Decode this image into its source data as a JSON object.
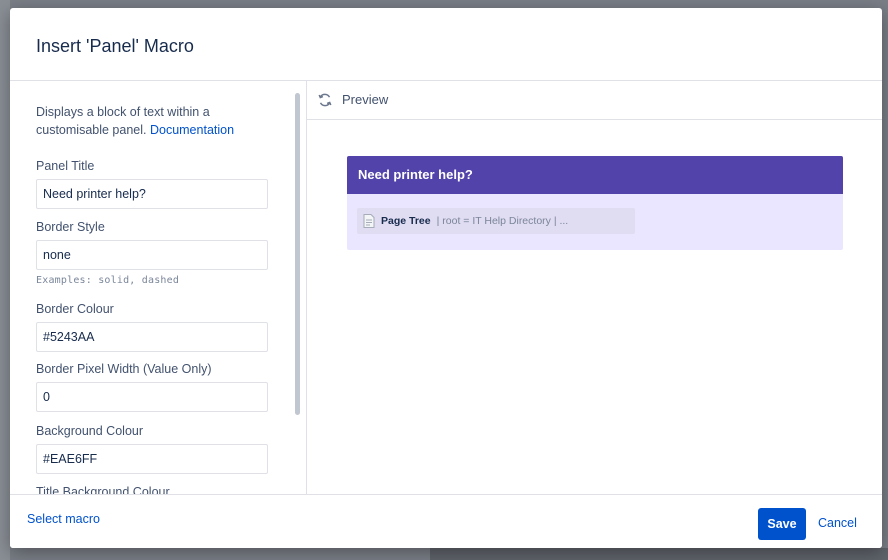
{
  "dialog": {
    "title": "Insert 'Panel' Macro"
  },
  "form": {
    "description": "Displays a block of text within a customisable panel.",
    "documentation_link": "Documentation",
    "fields": [
      {
        "label": "Panel Title",
        "value": "Need printer help?"
      },
      {
        "label": "Border Style",
        "value": "none",
        "hint": "Examples: solid, dashed"
      },
      {
        "label": "Border Colour",
        "value": "#5243AA"
      },
      {
        "label": "Border Pixel Width (Value Only)",
        "value": "0"
      },
      {
        "label": "Background Colour",
        "value": "#EAE6FF"
      },
      {
        "label": "Title Background Colour",
        "value": ""
      }
    ]
  },
  "preview": {
    "label": "Preview",
    "refresh_icon": "refresh-icon",
    "panel": {
      "title": "Need printer help?",
      "title_bg_color": "#5243AA",
      "bg_color": "#EAE6FF",
      "macro_icon": "page-tree-icon",
      "macro_name": "Page Tree",
      "macro_params": "| root = IT Help Directory | ..."
    }
  },
  "footer": {
    "select_macro": "Select macro",
    "save": "Save",
    "cancel": "Cancel"
  },
  "colors": {
    "primary": "#0052CC",
    "panel_title_bg": "#5243AA",
    "panel_bg": "#EAE6FF"
  }
}
